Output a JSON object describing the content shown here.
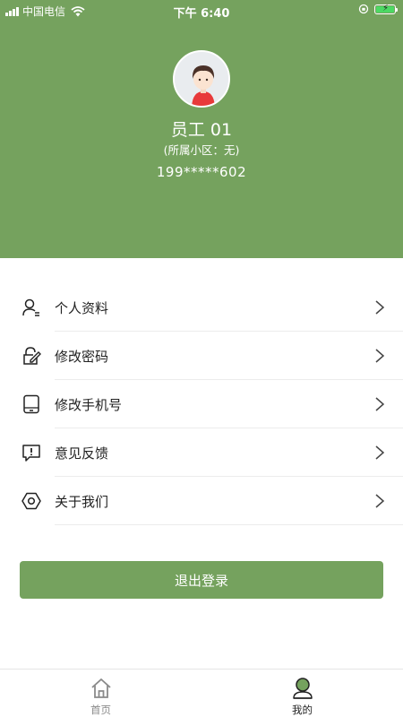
{
  "status_bar": {
    "carrier": "中国电信",
    "time": "下午 6:40"
  },
  "profile": {
    "name": "员工 01",
    "community": "(所属小区：无)",
    "phone": "199*****602"
  },
  "menu": [
    {
      "label": "个人资料",
      "icon": "user-profile-icon"
    },
    {
      "label": "修改密码",
      "icon": "edit-password-icon"
    },
    {
      "label": "修改手机号",
      "icon": "phone-icon"
    },
    {
      "label": "意见反馈",
      "icon": "feedback-icon"
    },
    {
      "label": "关于我们",
      "icon": "about-icon"
    }
  ],
  "logout_label": "退出登录",
  "tabs": [
    {
      "label": "首页",
      "icon": "home-icon",
      "active": false
    },
    {
      "label": "我的",
      "icon": "profile-icon",
      "active": true
    }
  ],
  "colors": {
    "primary": "#75a25e",
    "tab_inactive": "#8a8a8a",
    "tab_active": "#222222"
  }
}
